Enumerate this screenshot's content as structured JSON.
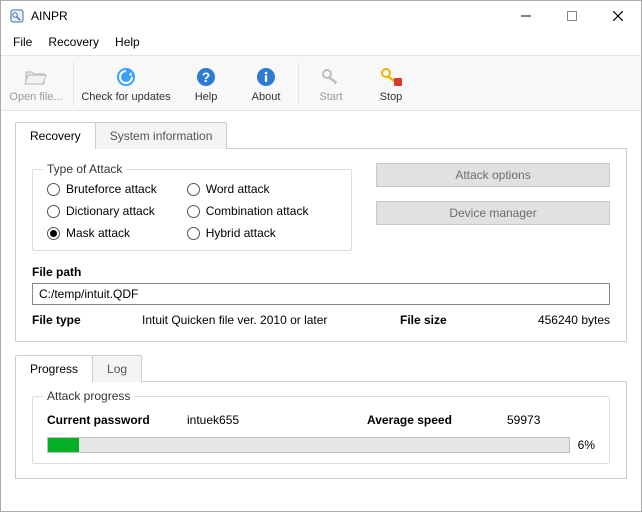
{
  "window": {
    "title": "AINPR"
  },
  "menu": {
    "file": "File",
    "recovery": "Recovery",
    "help": "Help"
  },
  "toolbar": {
    "open": "Open file...",
    "check_updates": "Check for updates",
    "help": "Help",
    "about": "About",
    "start": "Start",
    "stop": "Stop"
  },
  "tabs": {
    "recovery": "Recovery",
    "sysinfo": "System information"
  },
  "attack": {
    "group_title": "Type of Attack",
    "bruteforce": "Bruteforce attack",
    "dictionary": "Dictionary attack",
    "mask": "Mask attack",
    "word": "Word attack",
    "combination": "Combination attack",
    "hybrid": "Hybrid attack"
  },
  "buttons": {
    "attack_options": "Attack options",
    "device_manager": "Device manager"
  },
  "file": {
    "path_label": "File path",
    "path_value": "C:/temp/intuit.QDF",
    "type_label": "File type",
    "type_value": "Intuit Quicken file ver. 2010 or later",
    "size_label": "File size",
    "size_value": "456240 bytes"
  },
  "progress_tabs": {
    "progress": "Progress",
    "log": "Log"
  },
  "progress": {
    "group_title": "Attack progress",
    "current_label": "Current password",
    "current_value": "intuek655",
    "speed_label": "Average speed",
    "speed_value": "59973",
    "percent_text": "6%",
    "percent_value": 6
  }
}
